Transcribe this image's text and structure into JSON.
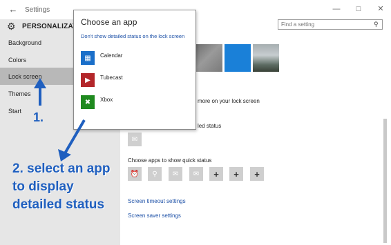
{
  "window": {
    "title": "Settings",
    "back_icon": "back-arrow-icon",
    "controls": [
      "minimize-icon",
      "maximize-icon",
      "close-icon"
    ]
  },
  "sidebar": {
    "heading": "PERSONALIZATION",
    "heading_icon": "gear-icon",
    "items": [
      {
        "label": "Background"
      },
      {
        "label": "Colors"
      },
      {
        "label": "Lock screen",
        "selected": true
      },
      {
        "label": "Themes"
      },
      {
        "label": "Start"
      }
    ]
  },
  "search": {
    "placeholder": "Find a setting",
    "icon": "search-icon"
  },
  "popup": {
    "title": "Choose an app",
    "option_none": "Don't show detailed status on the lock screen",
    "apps": [
      {
        "label": "Calendar",
        "icon": "calendar-icon",
        "color": "#1a6fc9"
      },
      {
        "label": "Tubecast",
        "icon": "tubecast-icon",
        "color": "#b3262a"
      },
      {
        "label": "Xbox",
        "icon": "xbox-icon",
        "color": "#1f8a1f"
      }
    ]
  },
  "main": {
    "more_text": "more on your lock screen",
    "detailed_status_text": "led status",
    "quick_status_label": "Choose apps to show quick status",
    "quick_status_icons": [
      "alarm-icon",
      "search-icon",
      "mail-icon",
      "mail-icon",
      "add-icon",
      "add-icon",
      "add-icon"
    ],
    "plus_glyph": "+",
    "screen_timeout_link": "Screen timeout settings",
    "screen_saver_link": "Screen saver settings"
  },
  "annotations": {
    "step1": "1.",
    "step2": "2. select an app\nto display\ndetailed status",
    "color": "#1f5fbf"
  }
}
